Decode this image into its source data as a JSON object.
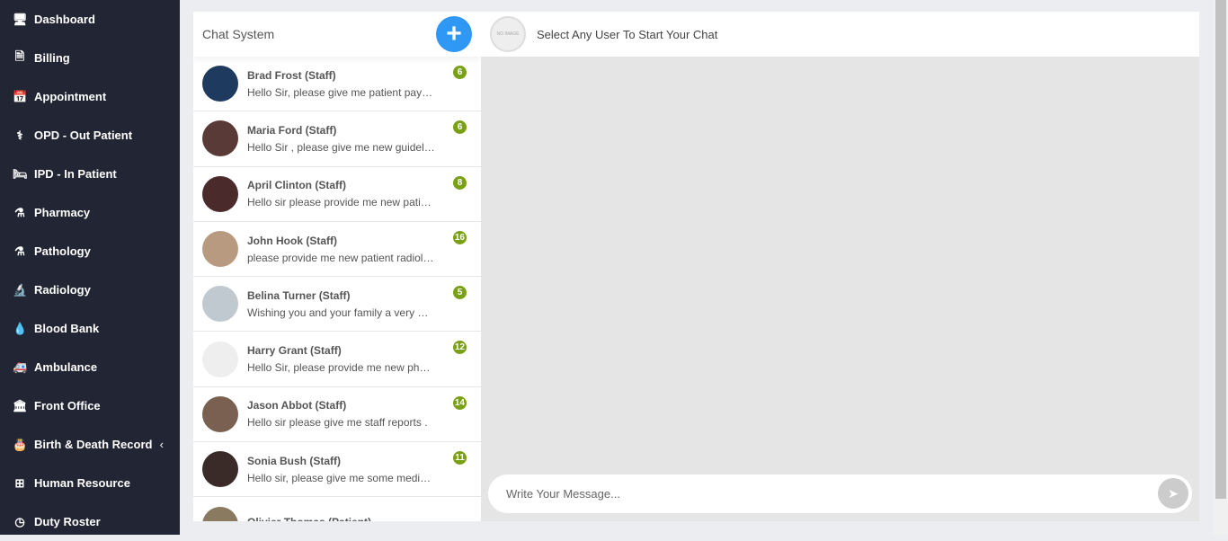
{
  "sidebar": {
    "items": [
      {
        "label": "Dashboard",
        "icon": "monitor-icon",
        "glyph": "🖥"
      },
      {
        "label": "Billing",
        "icon": "file-icon",
        "glyph": "🗎"
      },
      {
        "label": "Appointment",
        "icon": "calendar-check-icon",
        "glyph": "📅"
      },
      {
        "label": "OPD - Out Patient",
        "icon": "stethoscope-icon",
        "glyph": "⚕"
      },
      {
        "label": "IPD - In Patient",
        "icon": "bed-icon",
        "glyph": "🛏"
      },
      {
        "label": "Pharmacy",
        "icon": "mortar-pestle-icon",
        "glyph": "⚗"
      },
      {
        "label": "Pathology",
        "icon": "flask-icon",
        "glyph": "⚗"
      },
      {
        "label": "Radiology",
        "icon": "microscope-icon",
        "glyph": "🔬"
      },
      {
        "label": "Blood Bank",
        "icon": "tint-icon",
        "glyph": "💧"
      },
      {
        "label": "Ambulance",
        "icon": "ambulance-icon",
        "glyph": "🚑"
      },
      {
        "label": "Front Office",
        "icon": "building-icon",
        "glyph": "🏛"
      },
      {
        "label": "Birth & Death Record",
        "icon": "birthday-cake-icon",
        "glyph": "🎂"
      },
      {
        "label": "Human Resource",
        "icon": "sitemap-icon",
        "glyph": "⊞"
      },
      {
        "label": "Duty Roster",
        "icon": "clock-icon",
        "glyph": "◷"
      }
    ]
  },
  "list": {
    "title": "Chat System",
    "contacts": [
      {
        "name": "Brad Frost (Staff)",
        "message": "Hello Sir, please give me patient payment reports",
        "count": "6",
        "color": "#1e3a5f"
      },
      {
        "name": "Maria Ford (Staff)",
        "message": "Hello Sir , please give me new guideline",
        "count": "6",
        "color": "#5a3a36"
      },
      {
        "name": "April Clinton (Staff)",
        "message": "Hello sir please provide me new patient list",
        "count": "8",
        "color": "#4a2a2a"
      },
      {
        "name": "John Hook (Staff)",
        "message": "please provide me new patient radiology report",
        "count": "16",
        "color": "#b89a80"
      },
      {
        "name": "Belina Turner (Staff)",
        "message": "Wishing you and your family a very Happy New Year",
        "count": "5",
        "color": "#c0c8d0"
      },
      {
        "name": "Harry Grant (Staff)",
        "message": "Hello Sir, please provide me new pharmacy list",
        "count": "12",
        "color": "#eeeeee"
      },
      {
        "name": "Jason Abbot (Staff)",
        "message": "Hello sir please give me staff reports .",
        "count": "14",
        "color": "#7a6050"
      },
      {
        "name": "Sonia Bush (Staff)",
        "message": "Hello sir, please give me some medicine list",
        "count": "11",
        "color": "#3a2a28"
      },
      {
        "name": "Olivier Thomas (Patient)",
        "message": "",
        "count": "",
        "color": "#8a7a60"
      }
    ]
  },
  "chat": {
    "header": "Select Any User To Start Your Chat",
    "noimage": "NO IMAGE",
    "placeholder": "Write Your Message..."
  }
}
